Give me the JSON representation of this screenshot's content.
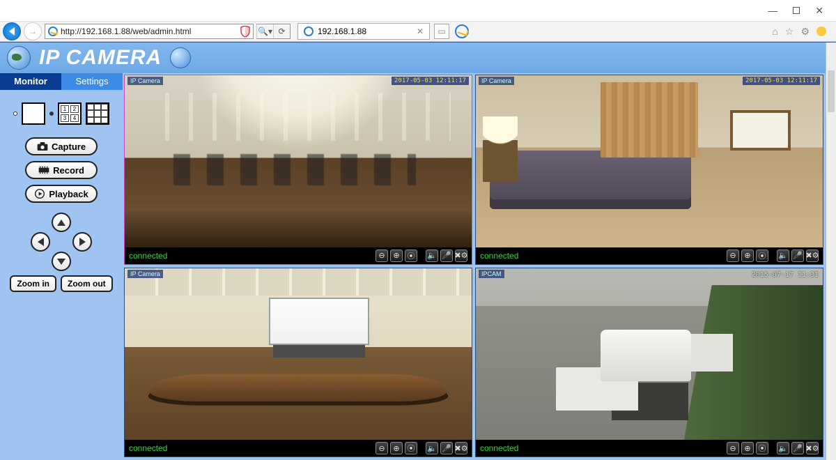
{
  "browser": {
    "url": "http://192.168.1.88/web/admin.html",
    "tab_title": "192.168.1.88"
  },
  "brand": {
    "title": "IP CAMERA"
  },
  "tabs": {
    "monitor": "Monitor",
    "settings": "Settings"
  },
  "layout_cells": [
    "1",
    "2",
    "3",
    "4"
  ],
  "buttons": {
    "capture": "Capture",
    "record": "Record",
    "playback": "Playback",
    "zoom_in": "Zoom in",
    "zoom_out": "Zoom out"
  },
  "cameras": [
    {
      "label": "IP Camera",
      "timestamp": "2017-05-03 12:11:17",
      "status": "connected"
    },
    {
      "label": "IP Camera",
      "timestamp": "2017-05-03 12:11:17",
      "status": "connected"
    },
    {
      "label": "IP Camera",
      "timestamp": "",
      "status": "connected"
    },
    {
      "label": "IPCAM",
      "timestamp": "2015-07-17 11:31",
      "status": "connected"
    }
  ]
}
